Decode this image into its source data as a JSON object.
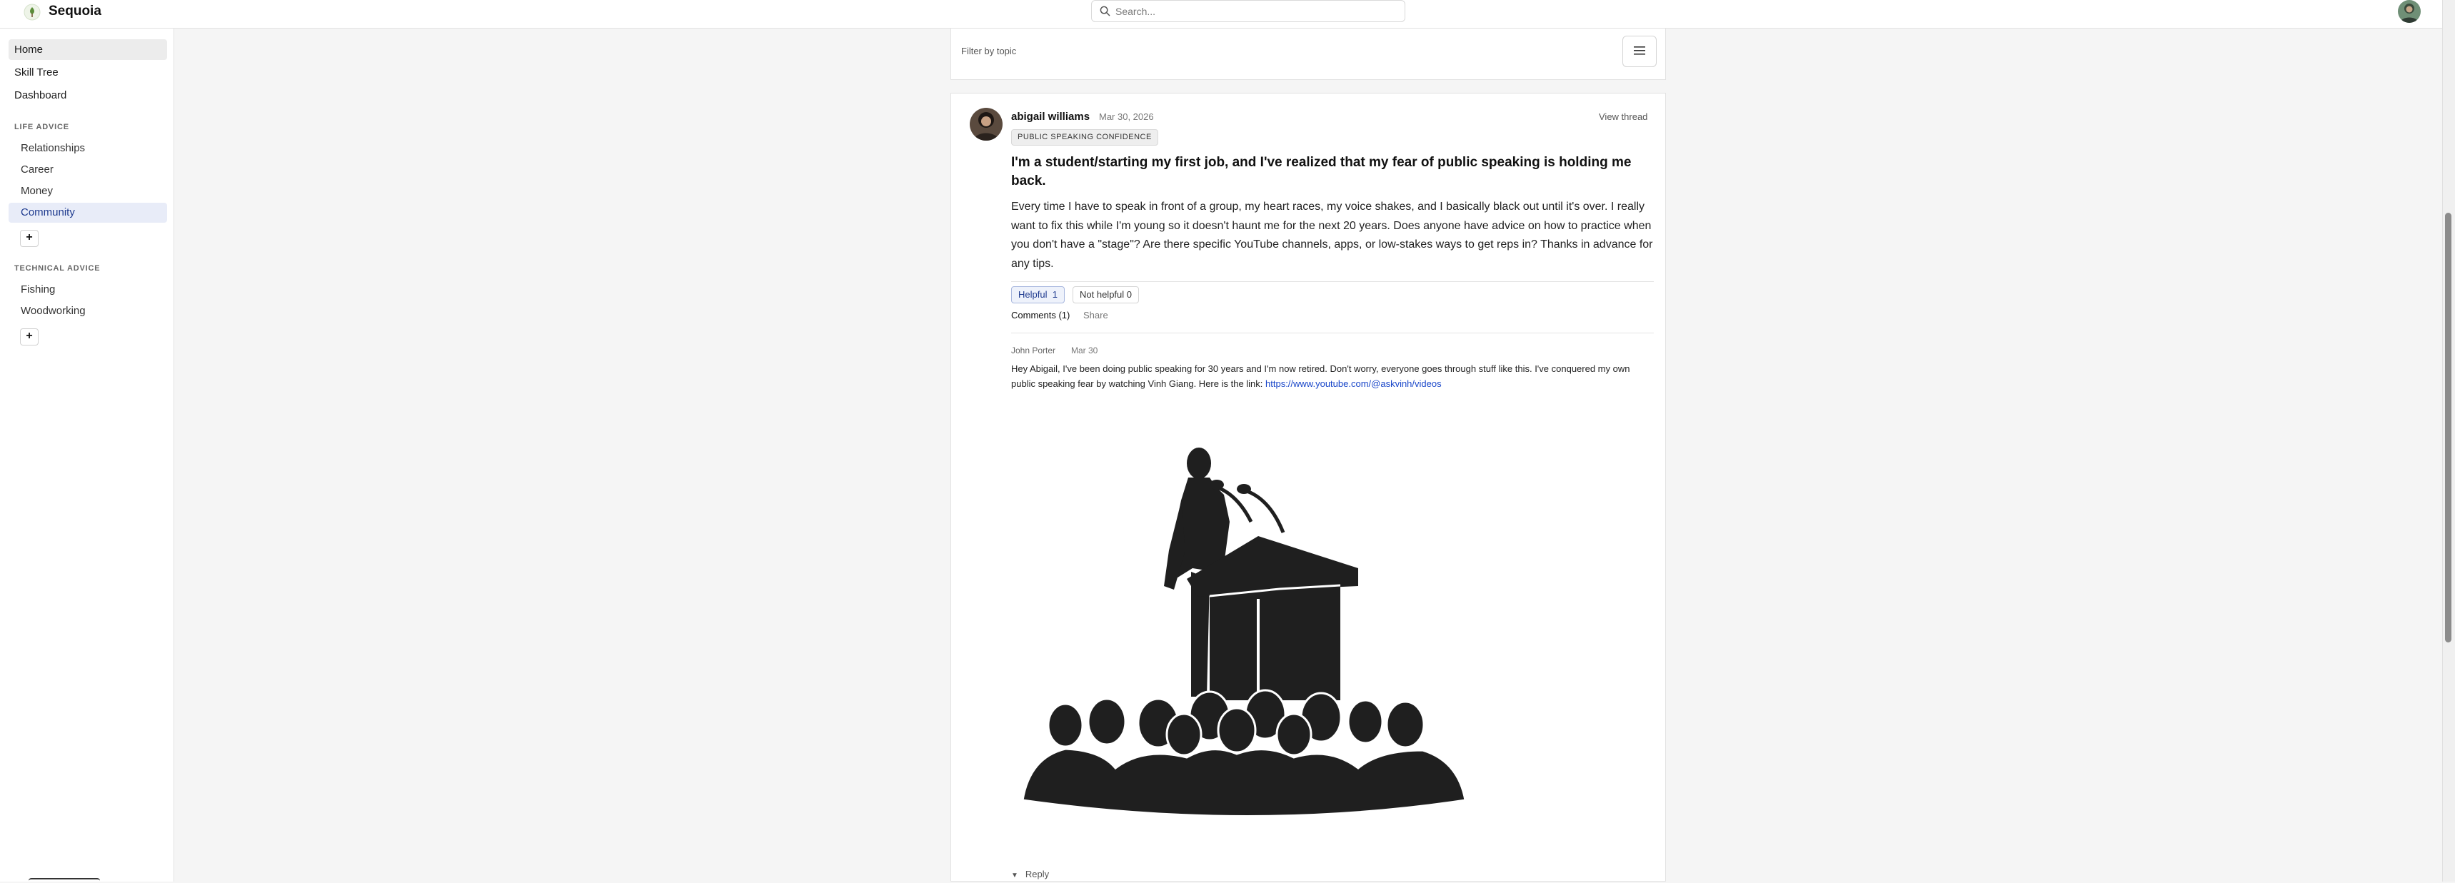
{
  "app": {
    "title": "Sequoia"
  },
  "search": {
    "placeholder": "Search..."
  },
  "sidebar": {
    "nav": [
      {
        "label": "Home"
      },
      {
        "label": "Skill Tree"
      },
      {
        "label": "Dashboard"
      }
    ],
    "sections": [
      {
        "label": "LIFE ADVICE",
        "items": [
          {
            "label": "Relationships"
          },
          {
            "label": "Career"
          },
          {
            "label": "Money"
          },
          {
            "label": "Community"
          }
        ],
        "add_label": "+"
      },
      {
        "label": "TECHNICAL ADVICE",
        "items": [
          {
            "label": "Fishing"
          },
          {
            "label": "Woodworking"
          }
        ],
        "add_label": "+"
      }
    ]
  },
  "filter": {
    "label": "Filter by topic",
    "menu_icon": "hamburger-icon"
  },
  "post": {
    "author": "abigail williams",
    "date": "Mar 30, 2026",
    "view_thread": "View thread",
    "topic": "PUBLIC SPEAKING CONFIDENCE",
    "title": "I'm a student/starting my first job, and I've realized that my fear of public speaking is holding me back.",
    "body": "Every time I have to speak in front of a group, my heart races, my voice shakes, and I basically black out until it's over. I really want to fix this while I'm young so it doesn't haunt me for the next 20 years. Does anyone have advice on how to practice when you don't have a \"stage\"? Are there specific YouTube channels, apps, or low-stakes ways to get reps in? Thanks in advance for any tips.",
    "helpful_label": "Helpful",
    "helpful_count": "1",
    "not_helpful_label": "Not helpful",
    "not_helpful_count": "0",
    "tab_comments": "Comments (1)",
    "tab_share": "Share"
  },
  "comment": {
    "author": "John Porter",
    "date": "Mar 30",
    "text": "Hey Abigail, I've been doing public speaking for 30 years and I'm now retired. Don't worry, everyone goes through stuff like this. I've conquered my own public speaking fear by watching Vinh Giang. Here is the link: ",
    "link": "https://www.youtube.com/@askvinh/videos",
    "image_icon": "public-speaker-podium-audience-illustration",
    "reply_label": "Reply"
  },
  "colors": {
    "accent": "#1f3b8f",
    "link": "#1a47c9",
    "active_nav": "#ececec",
    "active_sub": "#e8ecf8"
  }
}
